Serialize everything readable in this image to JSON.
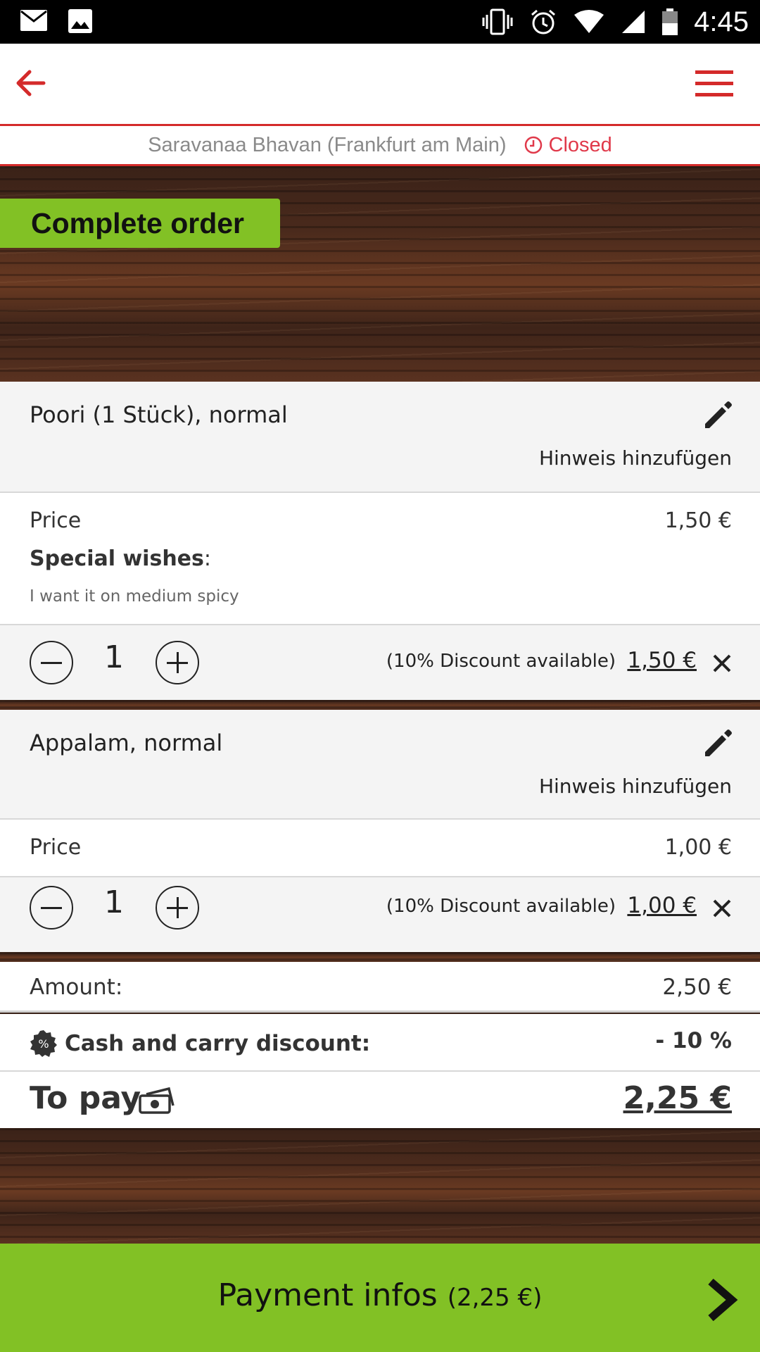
{
  "status_bar": {
    "time": "4:45",
    "icons": [
      "mail-icon",
      "image-icon",
      "vibrate-icon",
      "alarm-icon",
      "wifi-icon",
      "signal-icon",
      "battery-icon"
    ]
  },
  "header": {
    "restaurant": "Saravanaa Bhavan (Frankfurt am Main)",
    "status": "Closed",
    "accent_color": "#d42a2a"
  },
  "section_title": "Complete order",
  "items": [
    {
      "title": "Poori (1 Stück), normal",
      "note_link": "Hinweis hinzufügen",
      "price_label": "Price",
      "price": "1,50 €",
      "special_wishes_label": "Special wishes",
      "special_wishes_colon": ":",
      "special_wishes": "I want it on medium spicy",
      "quantity": "1",
      "discount_note": "(10% Discount available)",
      "line_total": "1,50 €"
    },
    {
      "title": "Appalam, normal",
      "note_link": "Hinweis hinzufügen",
      "price_label": "Price",
      "price": "1,00 €",
      "quantity": "1",
      "discount_note": "(10% Discount available)",
      "line_total": "1,00 €"
    }
  ],
  "totals": {
    "amount_label": "Amount:",
    "amount": "2,50 €",
    "discount_label": "Cash and carry discount:",
    "discount": "- 10 %",
    "to_pay_label": "To pay",
    "to_pay": "2,25 €"
  },
  "payment": {
    "label": "Payment infos",
    "amount": "(2,25 €)",
    "color": "#82c125"
  }
}
